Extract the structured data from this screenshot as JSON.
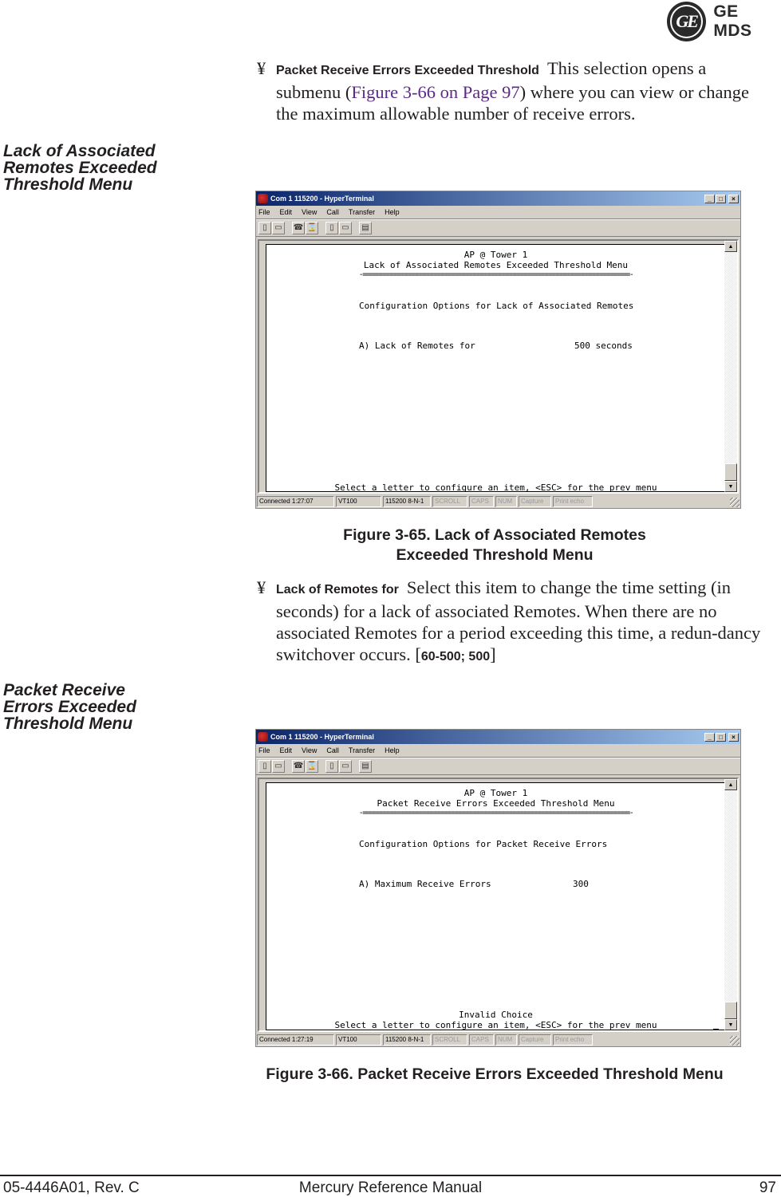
{
  "logo": {
    "monogram": "GE",
    "brand": "GE MDS"
  },
  "bullets": [
    {
      "symbol": "¥",
      "lead": "Packet Receive Errors Exceeded Threshold",
      "text_before_link": "This selection opens a submenu (",
      "link": "Figure 3-66 on Page 97",
      "text_after_link": ") where you can view or change the maximum allowable number of receive errors."
    },
    {
      "symbol": "¥",
      "lead": "Lack of Remotes for",
      "text": "Select this item to change the time setting (in seconds) for a lack of associated Remotes. When there are no associated Remotes for a period exceeding this time, a redun-dancy switchover occurs. [",
      "range": "60-500; 500",
      "text_end": "]"
    }
  ],
  "side_heads": [
    "Lack of Associated Remotes Exceeded Threshold Menu",
    "Packet Receive Errors Exceeded Threshold Menu"
  ],
  "side_heads_lines": [
    [
      "Lack of Associated",
      "Remotes Exceeded",
      "Threshold Menu"
    ],
    [
      "Packet Receive",
      "Errors Exceeded",
      "Threshold Menu"
    ]
  ],
  "captions": {
    "fig65_line1": "Figure 3-65. Lack of Associated Remotes",
    "fig65_line2": "Exceeded Threshold Menu",
    "fig66": "Figure 3-66. Packet Receive Errors Exceeded Threshold Menu"
  },
  "windows": [
    {
      "title": "Com 1 115200 - HyperTerminal",
      "menu": [
        "File",
        "Edit",
        "View",
        "Call",
        "Transfer",
        "Help"
      ],
      "toolbar_icons": [
        "new-icon",
        "open-icon",
        "connect-icon",
        "disconnect-icon",
        "send-icon",
        "receive-icon",
        "properties-icon"
      ],
      "terminal": {
        "header": "AP @ Tower 1",
        "menu_title": "Lack of Associated Remotes Exceeded Threshold Menu",
        "separator": "-==========================================================================-",
        "section": "Configuration Options for Lack of Associated Remotes",
        "option_label": "A) Lack of Remotes for",
        "option_value": "500 seconds",
        "message": "",
        "prompt": "Select a letter to configure an item, <ESC> for the prev menu"
      },
      "status": {
        "connected": "Connected 1:27:07",
        "emulation": "VT100",
        "port_settings": "115200 8-N-1",
        "scroll": "SCROLL",
        "caps": "CAPS",
        "num": "NUM",
        "capture": "Capture",
        "print_echo": "Print echo"
      }
    },
    {
      "title": "Com 1 115200 - HyperTerminal",
      "menu": [
        "File",
        "Edit",
        "View",
        "Call",
        "Transfer",
        "Help"
      ],
      "toolbar_icons": [
        "new-icon",
        "open-icon",
        "connect-icon",
        "disconnect-icon",
        "send-icon",
        "receive-icon",
        "properties-icon"
      ],
      "terminal": {
        "header": "AP @ Tower 1",
        "menu_title": "Packet Receive Errors Exceeded Threshold Menu",
        "separator": "-==========================================================================-",
        "section": "Configuration Options for Packet Receive Errors",
        "option_label": "A) Maximum Receive Errors",
        "option_value": "300",
        "message": "Invalid Choice",
        "prompt": "Select a letter to configure an item, <ESC> for the prev menu"
      },
      "status": {
        "connected": "Connected 1:27:19",
        "emulation": "VT100",
        "port_settings": "115200 8-N-1",
        "scroll": "SCROLL",
        "caps": "CAPS",
        "num": "NUM",
        "capture": "Capture",
        "print_echo": "Print echo"
      }
    }
  ],
  "footer": {
    "doc_number": "05-4446A01, Rev. C",
    "manual_title": "Mercury Reference Manual",
    "page_number": "97"
  }
}
